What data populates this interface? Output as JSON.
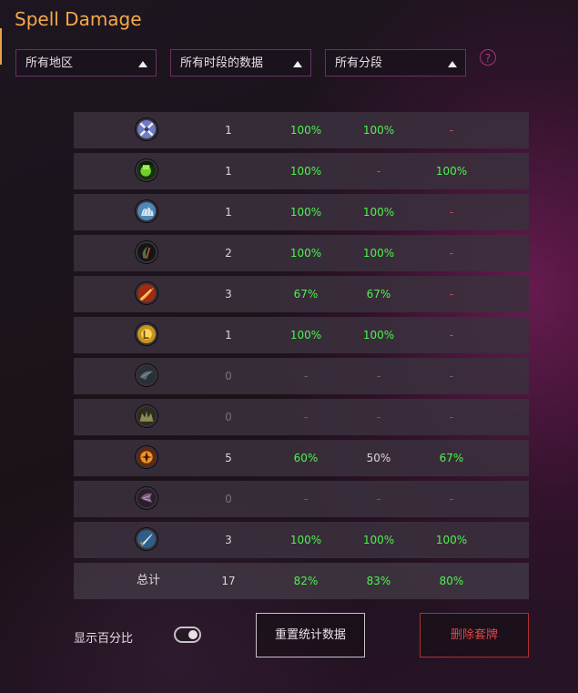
{
  "title": "Spell Damage",
  "filters": [
    {
      "label": "所有地区"
    },
    {
      "label": "所有时段的数据"
    },
    {
      "label": "所有分段"
    }
  ],
  "help": "?",
  "rows": [
    {
      "icon": "crossed-blades-icon",
      "count": "1",
      "p1": "100%",
      "p2": "100%",
      "p3": "-"
    },
    {
      "icon": "green-fist-icon",
      "count": "1",
      "p1": "100%",
      "p2": "-",
      "p3": "100%"
    },
    {
      "icon": "ice-claw-icon",
      "count": "1",
      "p1": "100%",
      "p2": "100%",
      "p3": "-"
    },
    {
      "icon": "dark-crescent-icon",
      "count": "2",
      "p1": "100%",
      "p2": "100%",
      "p3": "-"
    },
    {
      "icon": "fire-slash-icon",
      "count": "3",
      "p1": "67%",
      "p2": "67%",
      "p3": "-"
    },
    {
      "icon": "golden-rune-icon",
      "count": "1",
      "p1": "100%",
      "p2": "100%",
      "p3": "-"
    },
    {
      "icon": "shadow-wing-icon",
      "count": "0",
      "p1": "-",
      "p2": "-",
      "p3": "-"
    },
    {
      "icon": "spiked-crown-icon",
      "count": "0",
      "p1": "-",
      "p2": "-",
      "p3": "-"
    },
    {
      "icon": "burning-sigil-icon",
      "count": "5",
      "p1": "60%",
      "p2": "50%",
      "p3": "67%"
    },
    {
      "icon": "void-splash-icon",
      "count": "0",
      "p1": "-",
      "p2": "-",
      "p3": "-"
    },
    {
      "icon": "frost-sword-icon",
      "count": "3",
      "p1": "100%",
      "p2": "100%",
      "p3": "100%"
    }
  ],
  "total": {
    "label": "总计",
    "count": "17",
    "p1": "82%",
    "p2": "83%",
    "p3": "80%"
  },
  "show_percent_label": "显示百分比",
  "show_percent_on": true,
  "reset_button": "重置统计数据",
  "delete_button": "删除套牌",
  "colors": {
    "title": "#f6a84c",
    "positive": "#4ef24e",
    "negative": "#e55050",
    "filter_border": "#6e2f63",
    "delete": "#e24642"
  }
}
